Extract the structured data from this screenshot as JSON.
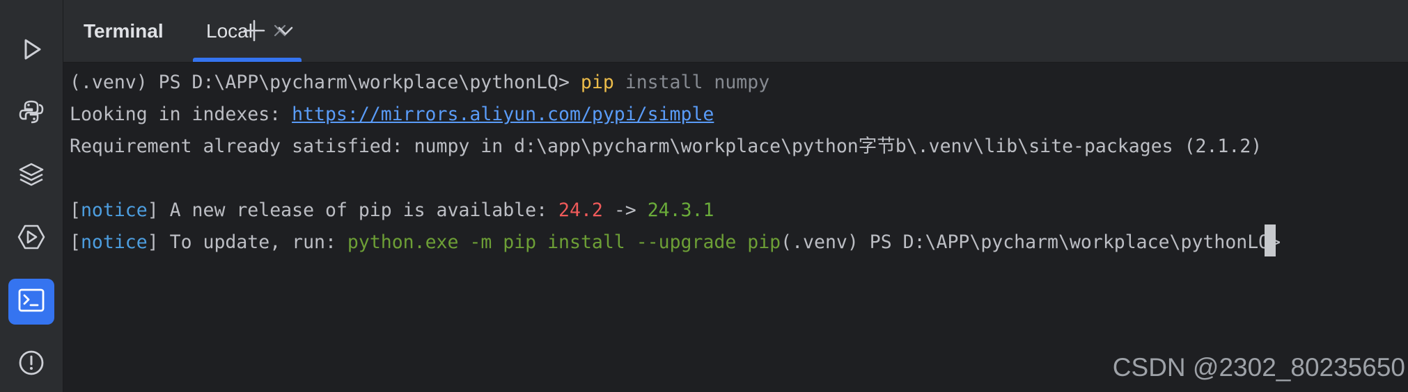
{
  "toolwindow": {
    "title": "Terminal",
    "tabs": [
      {
        "label": "Local",
        "active": true
      }
    ]
  },
  "sidebar": {
    "icons": [
      "run-icon",
      "python-console-icon",
      "layers-icon",
      "services-icon",
      "terminal-icon",
      "problems-icon"
    ],
    "active": "terminal-icon"
  },
  "terminal": {
    "line1": {
      "prompt": "(.venv) PS D:\\APP\\pycharm\\workplace\\pythonLQ> ",
      "command": "pip",
      "args": " install numpy"
    },
    "line2": {
      "label": "Looking in indexes: ",
      "url": "https://mirrors.aliyun.com/pypi/simple"
    },
    "line3": {
      "text": "Requirement already satisfied: numpy in d:\\app\\pycharm\\workplace\\python字节b\\.venv\\lib\\site-packages (2.1.2)"
    },
    "line4": {
      "bracket_open": "[",
      "notice": "notice",
      "bracket_close": "]",
      "text": " A new release of pip is available: ",
      "old_version": "24.2",
      "arrow": " -> ",
      "new_version": "24.3.1"
    },
    "line5": {
      "bracket_open": "[",
      "notice": "notice",
      "bracket_close": "]",
      "text": " To update, run: ",
      "command": "python.exe -m pip install --upgrade pip",
      "prompt": "(.venv) PS D:\\APP\\pycharm\\workplace\\pythonLQ> "
    }
  },
  "watermark": "CSDN @2302_80235650",
  "colors": {
    "accent": "#3574f0",
    "background": "#1e1f22",
    "panel": "#2b2d30",
    "command_yellow": "#ecbc4a",
    "link_blue": "#5a9cf8",
    "notice_blue": "#4d9ee0",
    "version_red": "#f05a5a",
    "version_green": "#6aab3a"
  }
}
